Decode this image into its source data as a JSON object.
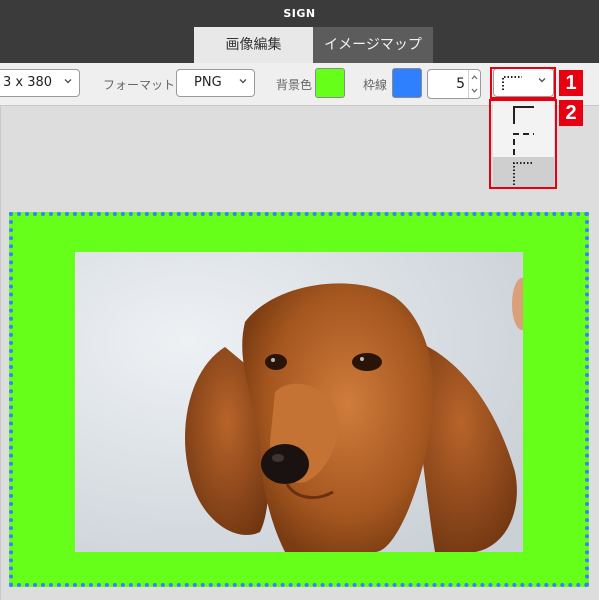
{
  "app": {
    "title": "SIGN"
  },
  "tabs": [
    {
      "label": "画像編集",
      "active": true
    },
    {
      "label": "イメージマップ",
      "active": false
    }
  ],
  "toolbar": {
    "size_value": "3 x 380",
    "format_label": "フォーマット",
    "format_value": "PNG",
    "bg_label": "背景色",
    "bg_color": "#66ff1a",
    "border_label": "枠線",
    "border_color": "#2f80ff",
    "border_width": "5",
    "border_style_selected": "dotted"
  },
  "border_style_options": [
    "solid",
    "dashed",
    "dotted"
  ],
  "annotations": {
    "badge_1": "1",
    "badge_2": "2",
    "highlight_color": "#e60012"
  },
  "canvas": {
    "frame_fill": "#66ff1a",
    "frame_border_color": "#3a7fff"
  }
}
